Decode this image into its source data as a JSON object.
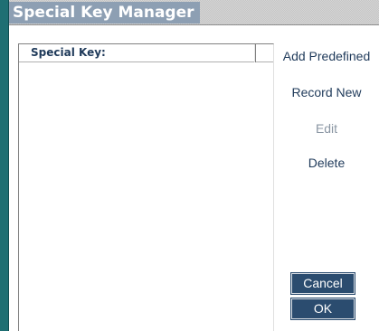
{
  "dialog": {
    "title": "Special Key Manager"
  },
  "list": {
    "column_header": "Special Key:",
    "items": []
  },
  "actions": {
    "add_predefined": "Add Predefined",
    "record_new": "Record New",
    "edit": "Edit",
    "delete": "Delete"
  },
  "buttons": {
    "cancel": "Cancel",
    "ok": "OK"
  },
  "colors": {
    "accent_teal": "#1f6f73",
    "title_highlight": "#8d9fb3",
    "button_fill": "#2b4c6f",
    "link_text": "#1f3a5a",
    "disabled_text": "#8a96a3"
  }
}
